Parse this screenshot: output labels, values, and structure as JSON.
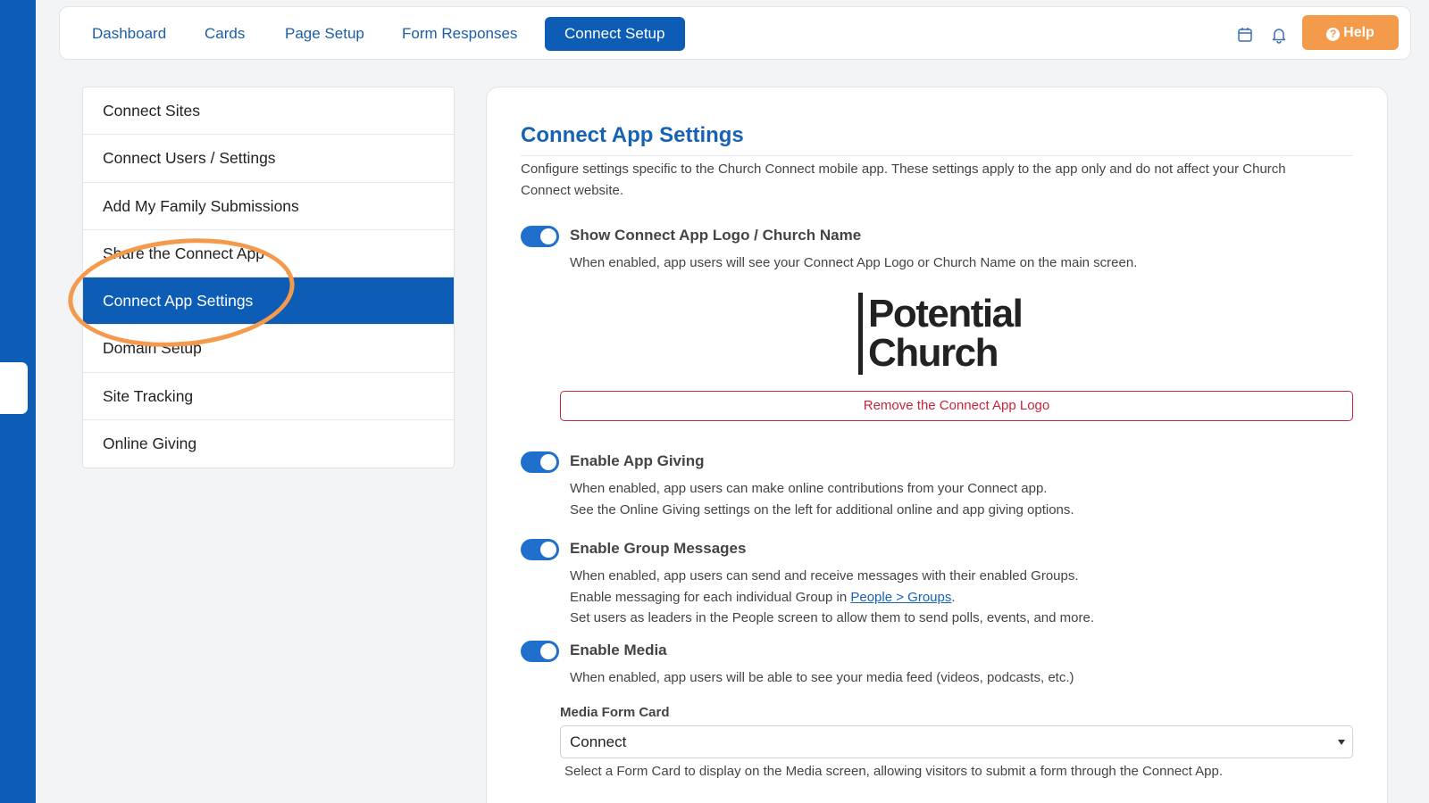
{
  "nav": {
    "tabs": [
      {
        "label": "Dashboard"
      },
      {
        "label": "Cards"
      },
      {
        "label": "Page Setup"
      },
      {
        "label": "Form Responses"
      },
      {
        "label": "Connect Setup",
        "active": true
      }
    ],
    "icons": [
      "calendar-icon",
      "bell-icon"
    ],
    "help_label": "Help"
  },
  "sidebar": {
    "items": [
      {
        "label": "Connect Sites"
      },
      {
        "label": "Connect Users / Settings"
      },
      {
        "label": "Add My Family Submissions"
      },
      {
        "label": "Share the Connect App"
      },
      {
        "label": "Connect App Settings",
        "active": true
      },
      {
        "label": "Domain Setup"
      },
      {
        "label": "Site Tracking"
      },
      {
        "label": "Online Giving"
      }
    ]
  },
  "main": {
    "title": "Connect App Settings",
    "intro": "Configure settings specific to the Church Connect mobile app. These settings apply to the app only and do not affect your Church Connect website.",
    "logo_setting": {
      "title": "Show Connect App Logo / Church Name",
      "desc": "When enabled, app users will see your Connect App Logo or Church Name on the main screen.",
      "enabled": true
    },
    "logo": {
      "line1": "Potential",
      "line2": "Church"
    },
    "remove_logo_label": "Remove the Connect App Logo",
    "giving": {
      "title": "Enable App Giving",
      "desc1": "When enabled, app users can make online contributions from your Connect app.",
      "desc2": "See the Online Giving settings on the left for additional online and app giving options.",
      "enabled": true
    },
    "groups": {
      "title": "Enable Group Messages",
      "desc1": "When enabled, app users can send and receive messages with their enabled Groups.",
      "desc2_prefix": "Enable messaging for each individual Group in ",
      "desc2_link": "People > Groups",
      "desc2_suffix": ".",
      "desc3": "Set users as leaders in the People screen to allow them to send polls, events, and more.",
      "enabled": true
    },
    "media": {
      "title": "Enable Media",
      "desc": "When enabled, app users will be able to see your media feed (videos, podcasts, etc.)",
      "enabled": true
    },
    "media_form": {
      "label": "Media Form Card",
      "value": "Connect",
      "help": "Select a Form Card to display on the Media screen, allowing visitors to submit a form through the Connect App."
    }
  },
  "colors": {
    "brand": "#0d5cb6",
    "accent": "#f49a4b",
    "danger": "#c8243a"
  }
}
